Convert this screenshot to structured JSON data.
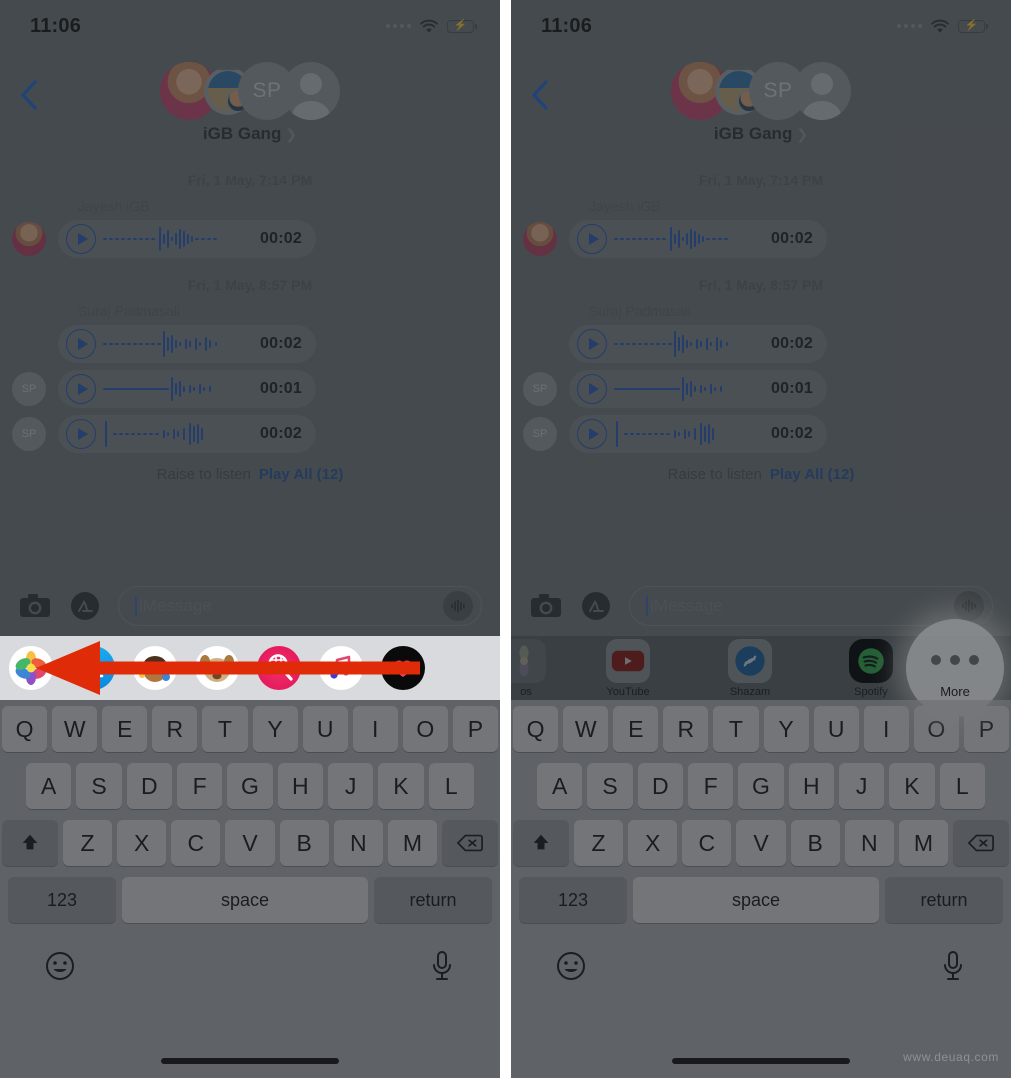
{
  "meta": {
    "watermark": "www.deuaq.com"
  },
  "status": {
    "time": "11:06",
    "wifi_icon": "wifi-icon",
    "battery_icon": "battery-charging-icon",
    "signal_icon": "signal-dots-icon"
  },
  "nav": {
    "back_icon": "back-chevron-icon",
    "group_name": "iGB Gang",
    "disclosure_icon": "chevron-right-icon",
    "avatars": [
      {
        "name": "avatar-jayesh",
        "initials": ""
      },
      {
        "name": "avatar-photo",
        "initials": ""
      },
      {
        "name": "avatar-sp",
        "initials": "SP"
      },
      {
        "name": "avatar-placeholder",
        "initials": ""
      }
    ]
  },
  "conversation": {
    "groups": [
      {
        "timestamp": "Fri, 1 May, 7:14 PM",
        "sender": "Jayesh iGB",
        "messages": [
          {
            "avatar_type": "photo",
            "avatar_initials": "",
            "duration": "00:02",
            "play_icon": "play-icon",
            "waveform_icon": "waveform-icon"
          }
        ]
      },
      {
        "timestamp": "Fri, 1 May, 8:57 PM",
        "sender": "Suraj Padmasali",
        "messages": [
          {
            "avatar_type": "none",
            "avatar_initials": "",
            "duration": "00:02",
            "play_icon": "play-icon",
            "waveform_icon": "waveform-icon"
          },
          {
            "avatar_type": "initials",
            "avatar_initials": "SP",
            "duration": "00:01",
            "play_icon": "play-icon",
            "waveform_icon": "waveform-icon"
          },
          {
            "avatar_type": "initials",
            "avatar_initials": "SP",
            "duration": "00:02",
            "play_icon": "play-icon",
            "waveform_icon": "waveform-icon"
          }
        ]
      }
    ],
    "raise_to_listen": "Raise to listen",
    "play_all": "Play All (12)"
  },
  "input_bar": {
    "camera_icon": "camera-icon",
    "appstore_icon": "app-store-icon",
    "placeholder": "iMessage",
    "value": "",
    "audio_icon": "audio-waveform-icon"
  },
  "drawer_left": {
    "apps": [
      {
        "label": "",
        "icon": "photos-icon"
      },
      {
        "label": "",
        "icon": "app-store-icon"
      },
      {
        "label": "",
        "icon": "memoji-icon"
      },
      {
        "label": "",
        "icon": "animoji-icon"
      },
      {
        "label": "",
        "icon": "images-hash-icon"
      },
      {
        "label": "",
        "icon": "music-icon"
      },
      {
        "label": "",
        "icon": "digital-touch-icon"
      }
    ]
  },
  "drawer_right": {
    "apps": [
      {
        "label": "os",
        "icon": "photos-icon"
      },
      {
        "label": "YouTube",
        "icon": "youtube-icon"
      },
      {
        "label": "Shazam",
        "icon": "shazam-icon"
      },
      {
        "label": "Spotify",
        "icon": "spotify-icon"
      }
    ],
    "more_label": "More",
    "more_icon": "more-ellipsis-icon"
  },
  "keyboard": {
    "row1": [
      "Q",
      "W",
      "E",
      "R",
      "T",
      "Y",
      "U",
      "I",
      "O",
      "P"
    ],
    "row2": [
      "A",
      "S",
      "D",
      "F",
      "G",
      "H",
      "J",
      "K",
      "L"
    ],
    "row3": [
      "Z",
      "X",
      "C",
      "V",
      "B",
      "N",
      "M"
    ],
    "shift_icon": "shift-icon",
    "delete_icon": "backspace-icon",
    "numbers_key": "123",
    "space_key": "space",
    "return_key": "return",
    "emoji_icon": "emoji-icon",
    "dictation_icon": "microphone-icon"
  },
  "colors": {
    "accent_blue": "#25519b",
    "keyboard_bg": "#c9ccd1",
    "drawer_bg": "#d8dade",
    "arrow_red": "#e02b08",
    "battery_green": "#3ac13a"
  }
}
